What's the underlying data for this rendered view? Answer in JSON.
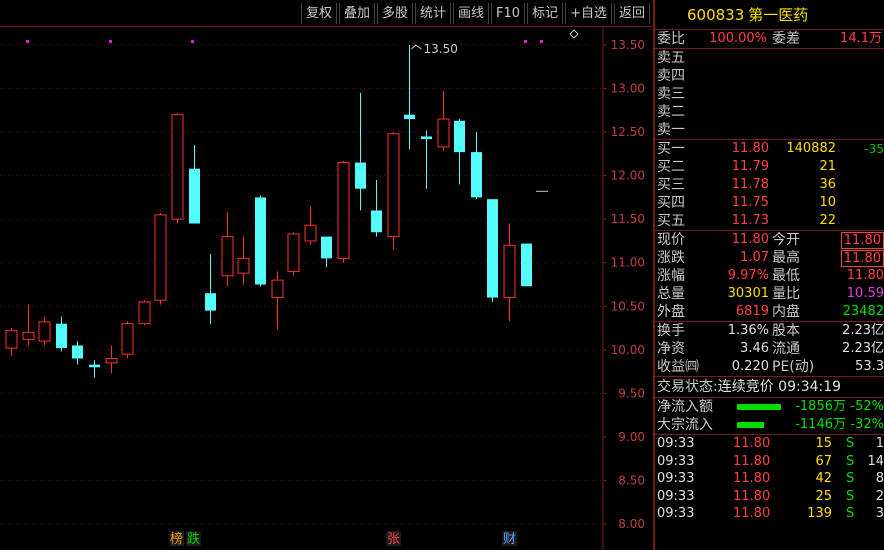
{
  "toolbar": {
    "buttons": [
      "复权",
      "叠加",
      "多股",
      "统计",
      "画线",
      "F10",
      "标记",
      "+自选",
      "返回"
    ]
  },
  "chart_data": {
    "type": "candlestick",
    "ylim": [
      7.9,
      13.75
    ],
    "y_ticks": [
      "13.50",
      "13.00",
      "12.50",
      "12.00",
      "11.50",
      "11.00",
      "10.50",
      "10.00",
      "9.50",
      "9.00",
      "8.50",
      "8.00"
    ],
    "high_label": "13.50",
    "candles": [
      {
        "o": 10.02,
        "c": 10.22,
        "h": 10.25,
        "l": 9.93
      },
      {
        "o": 10.12,
        "c": 10.2,
        "h": 10.52,
        "l": 10.05
      },
      {
        "o": 10.1,
        "c": 10.32,
        "h": 10.38,
        "l": 10.05
      },
      {
        "o": 10.3,
        "c": 10.02,
        "h": 10.38,
        "l": 9.98
      },
      {
        "o": 10.05,
        "c": 9.9,
        "h": 10.1,
        "l": 9.83
      },
      {
        "o": 9.83,
        "c": 9.8,
        "h": 9.88,
        "l": 9.68
      },
      {
        "o": 9.85,
        "c": 9.9,
        "h": 10.05,
        "l": 9.73
      },
      {
        "o": 9.95,
        "c": 10.3,
        "h": 10.33,
        "l": 9.9
      },
      {
        "o": 10.3,
        "c": 10.55,
        "h": 10.57,
        "l": 10.28
      },
      {
        "o": 10.57,
        "c": 11.55,
        "h": 11.57,
        "l": 10.52
      },
      {
        "o": 11.5,
        "c": 12.7,
        "h": 12.72,
        "l": 11.45
      },
      {
        "o": 12.08,
        "c": 11.45,
        "h": 12.35,
        "l": 11.45
      },
      {
        "o": 10.65,
        "c": 10.45,
        "h": 11.1,
        "l": 10.3
      },
      {
        "o": 10.85,
        "c": 11.3,
        "h": 11.58,
        "l": 10.73
      },
      {
        "o": 10.88,
        "c": 11.05,
        "h": 11.3,
        "l": 10.75
      },
      {
        "o": 11.75,
        "c": 10.75,
        "h": 11.77,
        "l": 10.73
      },
      {
        "o": 10.6,
        "c": 10.8,
        "h": 10.9,
        "l": 10.23
      },
      {
        "o": 10.9,
        "c": 11.33,
        "h": 11.35,
        "l": 10.85
      },
      {
        "o": 11.25,
        "c": 11.43,
        "h": 11.65,
        "l": 11.2
      },
      {
        "o": 11.3,
        "c": 11.05,
        "h": 11.3,
        "l": 10.95
      },
      {
        "o": 11.05,
        "c": 12.15,
        "h": 12.17,
        "l": 11.0
      },
      {
        "o": 12.15,
        "c": 11.85,
        "h": 12.95,
        "l": 11.6
      },
      {
        "o": 11.6,
        "c": 11.35,
        "h": 11.95,
        "l": 11.3
      },
      {
        "o": 11.3,
        "c": 12.48,
        "h": 12.5,
        "l": 11.15
      },
      {
        "o": 12.7,
        "c": 12.65,
        "h": 13.5,
        "l": 12.3
      },
      {
        "o": 12.45,
        "c": 12.42,
        "h": 12.52,
        "l": 11.85
      },
      {
        "o": 12.33,
        "c": 12.65,
        "h": 12.97,
        "l": 12.28
      },
      {
        "o": 12.63,
        "c": 12.27,
        "h": 12.65,
        "l": 11.9
      },
      {
        "o": 12.27,
        "c": 11.75,
        "h": 12.5,
        "l": 11.73
      },
      {
        "o": 11.73,
        "c": 10.6,
        "h": 11.73,
        "l": 10.55
      },
      {
        "o": 10.6,
        "c": 11.2,
        "h": 11.45,
        "l": 10.33
      },
      {
        "o": 11.22,
        "c": 10.73,
        "h": 11.22,
        "l": 10.73
      }
    ],
    "markers": [
      "榜",
      "跌",
      "张",
      "财"
    ]
  },
  "quote": {
    "code": "600833",
    "name": "第一医药",
    "weibi_label": "委比",
    "weibi": "100.00%",
    "weicha_label": "委差",
    "weicha": "14.1万",
    "asks": [
      "卖五",
      "卖四",
      "卖三",
      "卖二",
      "卖一"
    ],
    "bids": [
      {
        "label": "买一",
        "price": "11.80",
        "vol": "140882",
        "chg": "-35"
      },
      {
        "label": "买二",
        "price": "11.79",
        "vol": "21",
        "chg": ""
      },
      {
        "label": "买三",
        "price": "11.78",
        "vol": "36",
        "chg": ""
      },
      {
        "label": "买四",
        "price": "11.75",
        "vol": "10",
        "chg": ""
      },
      {
        "label": "买五",
        "price": "11.73",
        "vol": "22",
        "chg": ""
      }
    ],
    "stats1": [
      {
        "l1": "现价",
        "v1": "11.80",
        "c1": "red",
        "l2": "今开",
        "v2": "11.80",
        "c2": "red",
        "boxed": true
      },
      {
        "l1": "涨跌",
        "v1": "1.07",
        "c1": "red",
        "l2": "最高",
        "v2": "11.80",
        "c2": "red",
        "boxed": true
      },
      {
        "l1": "涨幅",
        "v1": "9.97%",
        "c1": "red",
        "l2": "最低",
        "v2": "11.80",
        "c2": "red",
        "boxed": false
      },
      {
        "l1": "总量",
        "v1": "30301",
        "c1": "yellow",
        "l2": "量比",
        "v2": "10.59",
        "c2": "magenta",
        "boxed": false
      },
      {
        "l1": "外盘",
        "v1": "6819",
        "c1": "red",
        "l2": "内盘",
        "v2": "23482",
        "c2": "green",
        "boxed": false
      }
    ],
    "stats2": [
      {
        "l1": "换手",
        "v1": "1.36%",
        "c1": "white",
        "l2": "股本",
        "v2": "2.23亿",
        "c2": "white"
      },
      {
        "l1": "净资",
        "v1": "3.46",
        "c1": "white",
        "l2": "流通",
        "v2": "2.23亿",
        "c2": "white"
      },
      {
        "l1": "收益㈣",
        "v1": "0.220",
        "c1": "white",
        "l2": "PE(动)",
        "v2": "53.3",
        "c2": "white"
      }
    ],
    "status_label": "交易状态:",
    "status_value": "连续竞价 09:34:19",
    "flows": [
      {
        "label": "净流入额",
        "amount": "-1856万",
        "pct": "-52%",
        "bar": 0.92
      },
      {
        "label": "大宗流入",
        "amount": "-1146万",
        "pct": "-32%",
        "bar": 0.57
      }
    ],
    "ticks": [
      {
        "t": "09:33",
        "p": "11.80",
        "v": "15",
        "s": "S",
        "n": "1"
      },
      {
        "t": "09:33",
        "p": "11.80",
        "v": "67",
        "s": "S",
        "n": "14"
      },
      {
        "t": "09:33",
        "p": "11.80",
        "v": "42",
        "s": "S",
        "n": "8"
      },
      {
        "t": "09:33",
        "p": "11.80",
        "v": "25",
        "s": "S",
        "n": "2"
      },
      {
        "t": "09:33",
        "p": "11.80",
        "v": "139",
        "s": "S",
        "n": "3"
      }
    ]
  }
}
